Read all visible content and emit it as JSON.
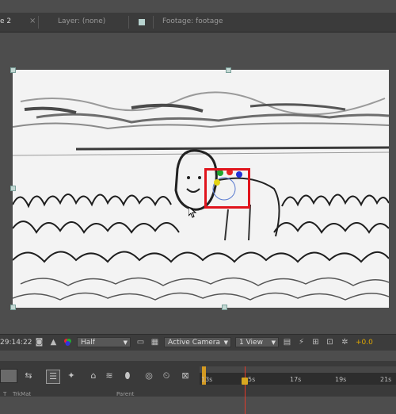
{
  "tabs": {
    "composition_suffix": "e 2",
    "layer": "Layer: (none)",
    "footage": "Footage: footage"
  },
  "viewer_bar": {
    "timecode": "29:14:22",
    "resolution": "Half",
    "camera": "Active Camera",
    "view_layout": "1 View",
    "exposure": "+0.0"
  },
  "timeline": {
    "ruler_ticks": [
      "13s",
      "5s",
      "17s",
      "19s",
      "21s"
    ],
    "columns": [
      "T",
      "TrkMat",
      "Parent"
    ]
  },
  "colors": {
    "selection_box": "#e0141c",
    "playhead": "#e23a2a",
    "accent_exposure": "#e0a800"
  },
  "icons": {
    "snapshot": "camera-icon",
    "grid": "grid-icon",
    "channel": "rgb-channel-icon",
    "motion_blur": "motion-blur-icon"
  }
}
